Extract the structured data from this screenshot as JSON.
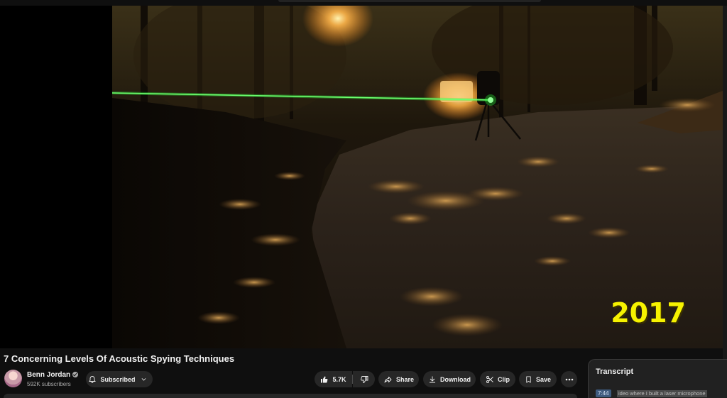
{
  "video": {
    "title": "7 Concerning Levels Of Acoustic Spying Techniques",
    "overlay_caption": "2017",
    "scene": "night-street-laser-beam"
  },
  "channel": {
    "name": "Benn Jordan",
    "subscribers": "592K subscribers",
    "verified": true
  },
  "actions": {
    "subscribed_label": "Subscribed",
    "like_count": "5.7K",
    "share_label": "Share",
    "download_label": "Download",
    "clip_label": "Clip",
    "save_label": "Save"
  },
  "transcript": {
    "title": "Transcript",
    "segments": [
      {
        "time": "7:44",
        "text": "ideo where I built a laser microphone"
      }
    ]
  },
  "icons": {
    "subscribed": "bell-icon",
    "subscribed_menu": "chevron-down-icon",
    "like": "thumbs-up-icon",
    "dislike": "thumbs-down-icon",
    "share": "share-arrow-icon",
    "download": "download-icon",
    "clip": "scissors-icon",
    "save": "bookmark-icon",
    "more": "more-horizontal-icon",
    "verified": "verified-check-icon"
  },
  "colors": {
    "background": "#0f0f0f",
    "pill": "#272727",
    "caption_yellow": "#f6f200",
    "laser_green": "#2dff3a",
    "timestamp_highlight": "#3e5a7e"
  }
}
